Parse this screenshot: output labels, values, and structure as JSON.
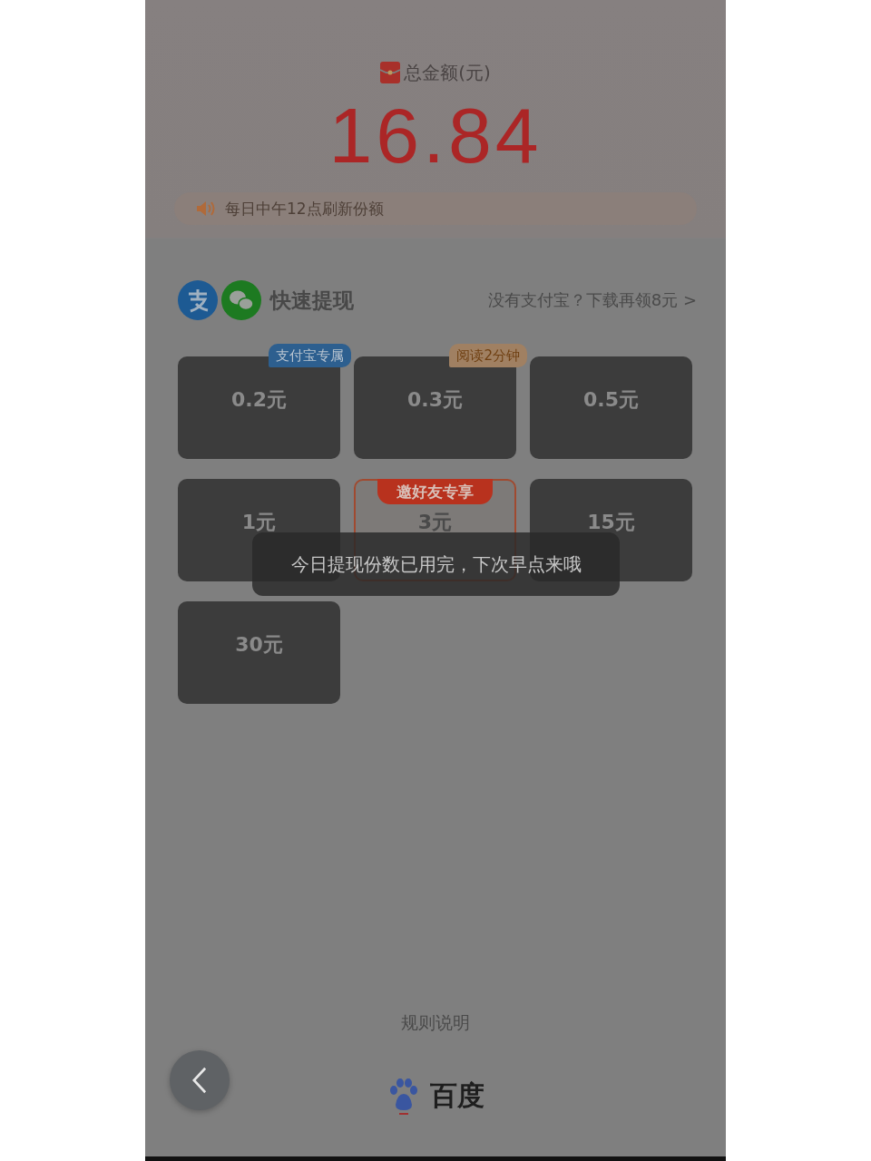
{
  "balance": {
    "label": "总金额(元)",
    "amount": "16.84"
  },
  "notice": "每日中午12点刷新份额",
  "withdraw": {
    "title": "快速提现",
    "link": "没有支付宝？下载再领8元 >",
    "options": [
      {
        "amount": "0.2元",
        "selected": false,
        "badge": {
          "kind": "tag",
          "text": "支付宝专属",
          "color": "#2d5f8f"
        }
      },
      {
        "amount": "0.3元",
        "selected": false,
        "badge": {
          "kind": "tag",
          "text": "阅读2分钟",
          "color": "#a08062"
        }
      },
      {
        "amount": "0.5元",
        "selected": false
      },
      {
        "amount": "1元",
        "selected": false
      },
      {
        "amount": "3元",
        "selected": true,
        "badge": {
          "kind": "ribbon",
          "text": "邀好友专享",
          "color": "#b8321e"
        }
      },
      {
        "amount": "15元",
        "selected": false
      },
      {
        "amount": "30元",
        "selected": false
      }
    ]
  },
  "toast": "今日提现份数已用完，下次早点来哦",
  "footer": {
    "rules_link": "规则说明",
    "brand": "百度"
  }
}
